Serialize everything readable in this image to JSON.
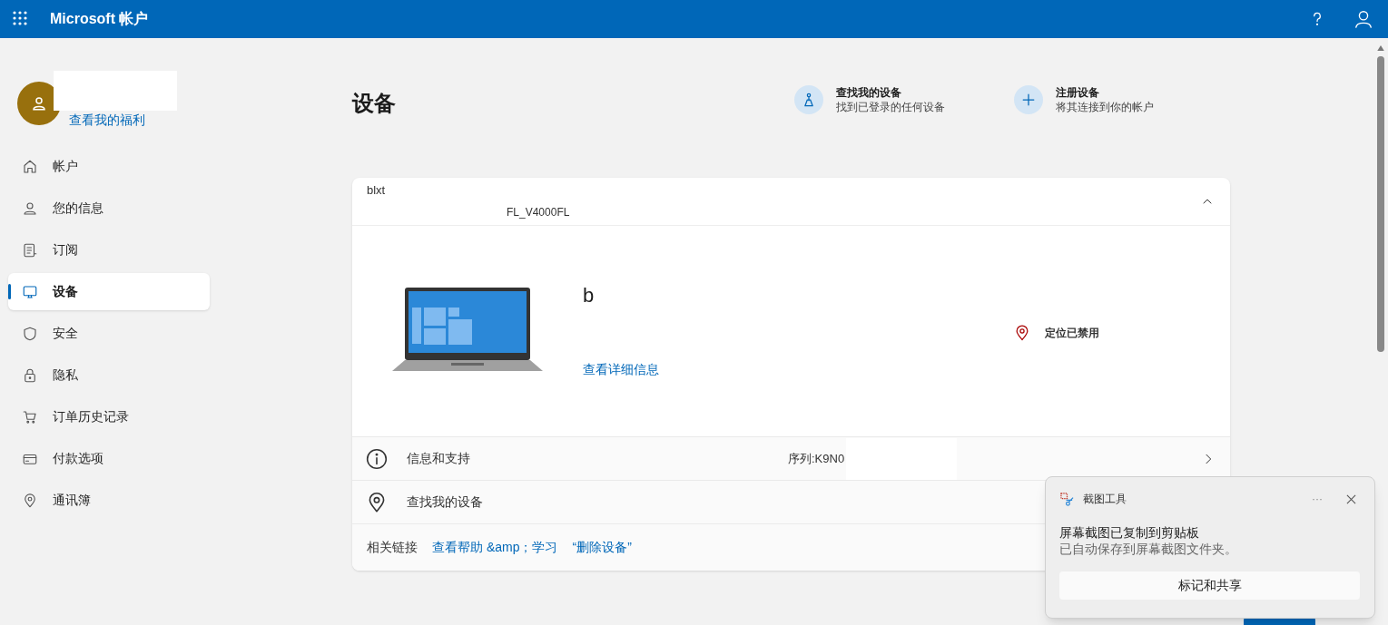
{
  "header": {
    "title": "Microsoft 帐户"
  },
  "profile": {
    "link": "查看我的福利"
  },
  "sidebar": {
    "items": [
      {
        "label": "帐户",
        "selected": false
      },
      {
        "label": "您的信息",
        "selected": false
      },
      {
        "label": "订阅",
        "selected": false
      },
      {
        "label": "设备",
        "selected": true
      },
      {
        "label": "安全",
        "selected": false
      },
      {
        "label": "隐私",
        "selected": false
      },
      {
        "label": "订单历史记录",
        "selected": false
      },
      {
        "label": "付款选项",
        "selected": false
      },
      {
        "label": "通讯簿",
        "selected": false
      }
    ]
  },
  "page": {
    "title": "设备",
    "actions": [
      {
        "title": "查找我的设备",
        "subtitle": "找到已登录的任何设备"
      },
      {
        "title": "注册设备",
        "subtitle": "将其连接到你的帐户"
      }
    ]
  },
  "device": {
    "name_top": "blxt",
    "model": "FL_V4000FL",
    "expanded": true,
    "display_name": "b",
    "details_link": "查看详细信息",
    "location": "定位已禁用",
    "rows": [
      {
        "kind": "info",
        "label": "信息和支持",
        "value": "序列:K9N0",
        "chevron": true
      },
      {
        "kind": "location",
        "label": "查找我的设备",
        "chevron": false
      }
    ],
    "related_label": "相关链接",
    "related_links": [
      "查看帮助 &amp；学习",
      "“删除设备”"
    ]
  },
  "toast": {
    "app": "截图工具",
    "menu": "···",
    "title": "屏幕截图已复制到剪贴板",
    "message": "已自动保存到屏幕截图文件夹。",
    "button": "标记和共享"
  }
}
